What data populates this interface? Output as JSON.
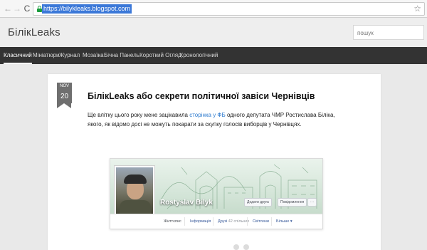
{
  "browser": {
    "url": "https://bilykleaks.blogspot.com",
    "back_glyph": "←",
    "forward_glyph": "→",
    "reload_glyph": "C",
    "star_glyph": "☆"
  },
  "blog": {
    "title": "БілікLeaks",
    "search_placeholder": "пошук"
  },
  "nav": {
    "items": [
      {
        "label": "Класичний",
        "active": true
      },
      {
        "label": "Мініатюри",
        "active": false
      },
      {
        "label": "Журнал",
        "active": false
      },
      {
        "label": "Мозаїка",
        "active": false
      },
      {
        "label": "Бічна Панель",
        "active": false
      },
      {
        "label": "Короткий Огляд",
        "active": false
      },
      {
        "label": "Хронологічний",
        "active": false
      }
    ]
  },
  "post": {
    "date_month": "NOV",
    "date_day": "20",
    "title": "БілікLeaks або секрети політичної завіси Чернівців",
    "body_part1": "Ще влітку цього року мене зацікавила ",
    "body_link": "сторінка у ФБ",
    "body_part2": " одного депутата ЧМР Ростислава Біліка, якого, як відомо досі не можуть покарати за скупку голосів виборців у Чернівцях."
  },
  "facebook": {
    "name": "Rostyslav Bilyk",
    "add_friend": "Додати друга",
    "message": "Повідомлення",
    "more_btn": "···",
    "tabs": {
      "timeline": "Життєпис",
      "info": "Інформація",
      "friends": "Друзі",
      "friends_count": "42 спільних",
      "photos": "Світлини",
      "more": "Більше ▾"
    }
  },
  "colors": {
    "nav_bg": "#333333",
    "link": "#2e7bcf",
    "url_highlight": "#3b78d8",
    "lock": "#1a9c3c",
    "date_badge": "#6f6f6f"
  }
}
